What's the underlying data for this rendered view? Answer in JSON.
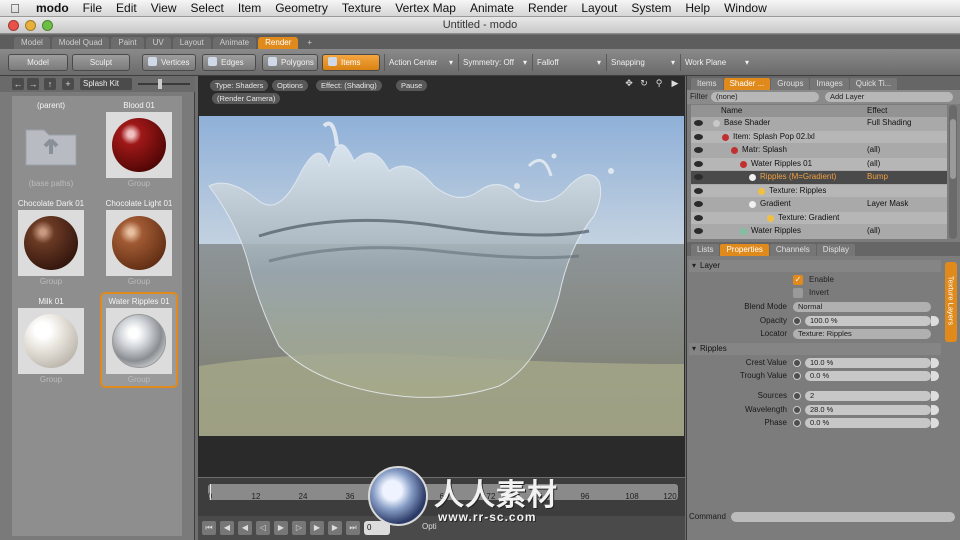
{
  "menubar": {
    "app": "modo",
    "items": [
      "File",
      "Edit",
      "View",
      "Select",
      "Item",
      "Geometry",
      "Texture",
      "Vertex Map",
      "Animate",
      "Render",
      "Layout",
      "System",
      "Help",
      "Window"
    ]
  },
  "window": {
    "title": "Untitled - modo"
  },
  "layout_tabs": {
    "items": [
      "Model",
      "Model Quad",
      "Paint",
      "UV",
      "Layout",
      "Animate",
      "Render"
    ],
    "active": "Render",
    "add": "+"
  },
  "toolbar": {
    "model": "Model",
    "sculpt": "Sculpt",
    "vertices": "Vertices",
    "edges": "Edges",
    "polygons": "Polygons",
    "items": "Items",
    "action_center": "Action Center",
    "symmetry": "Symmetry: Off",
    "falloff": "Falloff",
    "snapping": "Snapping",
    "work_plane": "Work Plane"
  },
  "library": {
    "kit": "Splash Kit",
    "presets": [
      {
        "name": "(parent)",
        "type": "(base paths)",
        "icon": "folder-up-icon",
        "color": ""
      },
      {
        "name": "Blood 01",
        "type": "Group",
        "icon": "sphere",
        "color": "#7a1010"
      },
      {
        "name": "Chocolate Dark 01",
        "type": "Group",
        "icon": "sphere",
        "color": "#5a2a1a"
      },
      {
        "name": "Chocolate Light 01",
        "type": "Group",
        "icon": "sphere",
        "color": "#8a4a2c"
      },
      {
        "name": "Milk 01",
        "type": "Group",
        "icon": "sphere",
        "color": "#e6e2da"
      },
      {
        "name": "Water Ripples 01",
        "type": "Group",
        "icon": "sphere",
        "color": "#c8ccd0"
      }
    ]
  },
  "viewport": {
    "type": "Type: Shaders",
    "options": "Options",
    "effect": "Effect: (Shading)",
    "pause": "Pause",
    "camera": "(Render Camera)"
  },
  "timeline": {
    "ticks": [
      "0",
      "12",
      "24",
      "36",
      "48",
      "60",
      "72",
      "84",
      "96",
      "108",
      "120"
    ],
    "frame": "0",
    "options_label": "Opti"
  },
  "watermark": {
    "text": "人人素材",
    "url": "www.rr-sc.com"
  },
  "right_panel": {
    "top_tabs": [
      "Items",
      "Shader ...",
      "Groups",
      "Images",
      "Quick Ti..."
    ],
    "top_active": "Shader ...",
    "filter_label": "Filter",
    "filter_value": "(none)",
    "add_layer": "Add Layer",
    "columns": {
      "name": "Name",
      "effect": "Effect"
    },
    "tree": [
      {
        "name": "Base Shader",
        "effect": "Full Shading",
        "indent": 0,
        "node_color": "#c8c8c8",
        "selected": false
      },
      {
        "name": "Item: Splash Pop 02.lxl",
        "effect": "",
        "indent": 1,
        "node_color": "#c03030",
        "selected": false
      },
      {
        "name": "Matr: Splash",
        "effect": "(all)",
        "indent": 2,
        "node_color": "#c03030",
        "selected": false
      },
      {
        "name": "Water Ripples 01",
        "effect": "(all)",
        "indent": 3,
        "node_color": "#c03030",
        "selected": false
      },
      {
        "name": "Ripples (M=Gradient)",
        "effect": "Bump",
        "indent": 4,
        "node_color": "#f0f0f0",
        "selected": true
      },
      {
        "name": "Texture: Ripples",
        "effect": "",
        "indent": 5,
        "node_color": "#f0c040",
        "selected": false
      },
      {
        "name": "Gradient",
        "effect": "Layer Mask",
        "indent": 4,
        "node_color": "#f0f0f0",
        "selected": false
      },
      {
        "name": "Texture: Gradient",
        "effect": "",
        "indent": 6,
        "node_color": "#f0c040",
        "selected": false
      },
      {
        "name": "Water Ripples",
        "effect": "(all)",
        "indent": 3,
        "node_color": "#80c0a0",
        "selected": false
      }
    ],
    "bottom_tabs": [
      "Lists",
      "Properties",
      "Channels",
      "Display"
    ],
    "bottom_active": "Properties",
    "layer_section": "Layer",
    "enable": "Enable",
    "invert": "Invert",
    "blend_mode_label": "Blend Mode",
    "blend_mode": "Normal",
    "opacity_label": "Opacity",
    "opacity": "100.0 %",
    "locator_label": "Locator",
    "locator": "Texture: Ripples",
    "ripples_section": "Ripples",
    "crest_label": "Crest Value",
    "crest": "10.0 %",
    "trough_label": "Trough Value",
    "trough": "0.0 %",
    "sources_label": "Sources",
    "sources": "2",
    "wavelength_label": "Wavelength",
    "wavelength": "28.0 %",
    "phase_label": "Phase",
    "phase": "0.0 %",
    "side_tab": "Texture Layers",
    "command_label": "Command"
  },
  "colors": {
    "accent": "#e08a1c",
    "panel": "#7c7c7c",
    "sky": "#9fb6d6",
    "ground": "#8a8a7a"
  }
}
